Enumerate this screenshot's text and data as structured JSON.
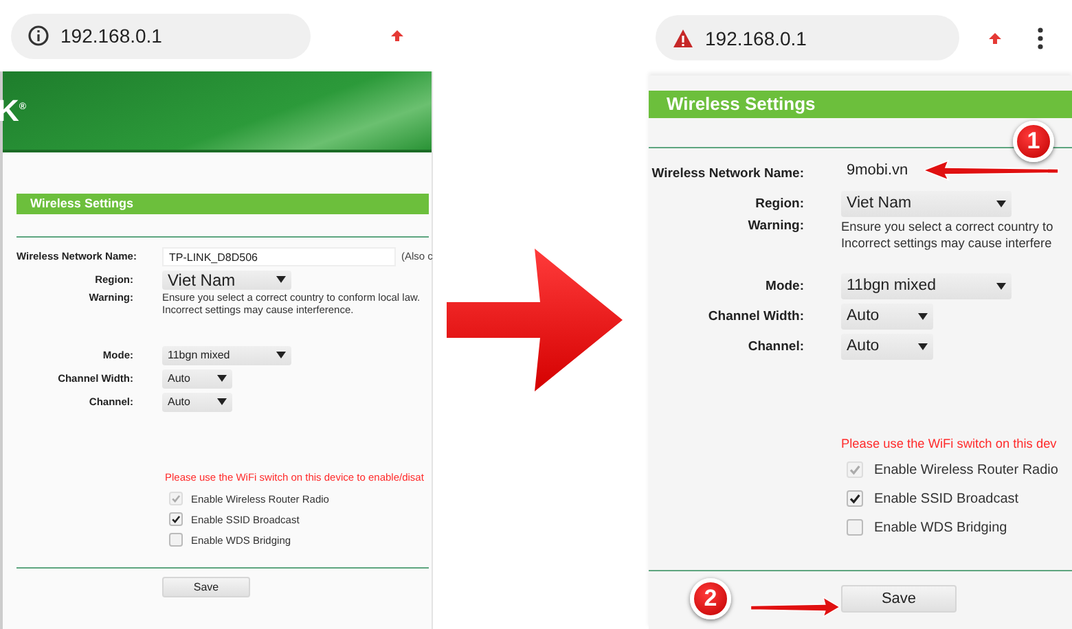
{
  "panels": [
    {
      "kind": "desktop_view",
      "address_bar": {
        "url": "192.168.0.1"
      },
      "banner": {
        "logo_text": "K$^{®}$"
      },
      "section_title": "Wireless Settings",
      "fields": [
        {
          "kind": "text",
          "label": "Wireless Network Name:",
          "value": "TP-LINK_D8D506",
          "note": "(Also c"
        },
        {
          "kind": "select",
          "label": "Region:",
          "value": "Viet Nam"
        },
        {
          "kind": "note",
          "label": "Warning:",
          "lines": [
            "Ensure you select a correct country to conform local law.",
            "Incorrect settings may cause interference."
          ]
        },
        {
          "kind": "select",
          "label": "Mode:",
          "value": "11bgn mixed"
        },
        {
          "kind": "select",
          "label": "Channel Width:",
          "value": "Auto"
        },
        {
          "kind": "select",
          "label": "Channel:",
          "value": "Auto"
        }
      ],
      "notice": "Please use the WiFi switch on this device to enable/disat",
      "checkboxes": [
        {
          "label": "Enable Wireless Router Radio",
          "checked": true,
          "disabled": true
        },
        {
          "label": "Enable SSID Broadcast",
          "checked": true,
          "disabled": false
        },
        {
          "label": "Enable WDS Bridging",
          "checked": false,
          "disabled": false
        }
      ],
      "save": "Save"
    },
    {
      "kind": "mobile_view",
      "address_bar": {
        "url": "192.168.0.1"
      },
      "section_title": "Wireless Settings",
      "fields": [
        {
          "kind": "text",
          "label": "Wireless Network Name:",
          "value": "9mobi.vn"
        },
        {
          "kind": "select",
          "label": "Region:",
          "value": "Viet Nam"
        },
        {
          "kind": "note",
          "label": "Warning:",
          "lines": [
            "Ensure you select a correct country to",
            "Incorrect settings may cause interfere"
          ]
        },
        {
          "kind": "select",
          "label": "Mode:",
          "value": "11bgn mixed"
        },
        {
          "kind": "select",
          "label": "Channel Width:",
          "value": "Auto"
        },
        {
          "kind": "select",
          "label": "Channel:",
          "value": "Auto"
        }
      ],
      "notice": "Please use the WiFi switch on this dev",
      "checkboxes": [
        {
          "label": "Enable Wireless Router Radio",
          "checked": true,
          "disabled": true
        },
        {
          "label": "Enable SSID Broadcast",
          "checked": true,
          "disabled": false
        },
        {
          "label": "Enable WDS Bridging",
          "checked": false,
          "disabled": false
        }
      ],
      "save": "Save"
    }
  ],
  "callouts": [
    {
      "number": "1"
    },
    {
      "number": "2"
    }
  ]
}
